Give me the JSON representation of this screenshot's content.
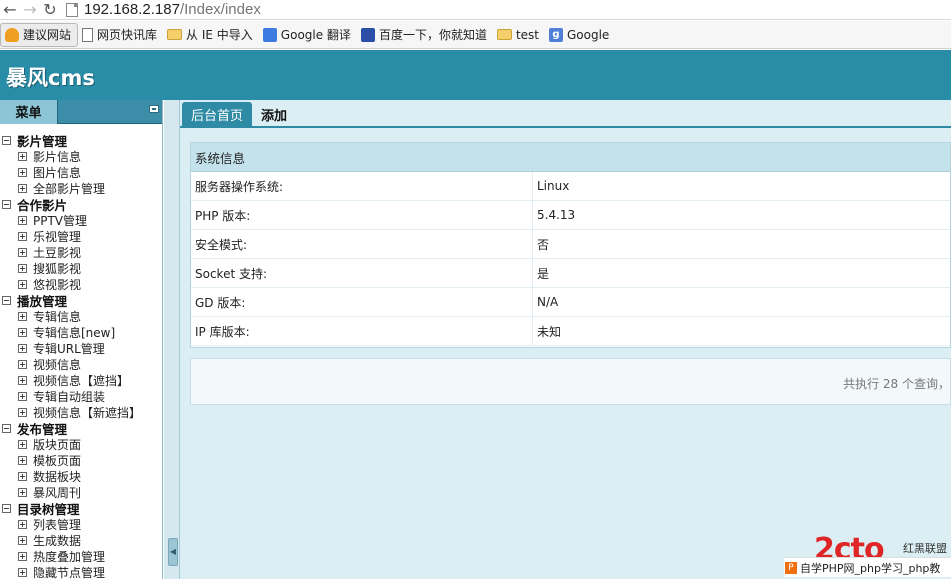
{
  "browser": {
    "url_host": "192.168.2.187",
    "url_path": "/Index/index",
    "bookmarks": [
      "建议网站",
      "网页快讯库",
      "从 IE 中导入",
      "Google 翻译",
      "百度一下，你就知道",
      "test",
      "Google"
    ]
  },
  "app": {
    "logo": "暴风cms"
  },
  "sidebar": {
    "title": "菜单",
    "groups": [
      {
        "label": "影片管理",
        "items": [
          "影片信息",
          "图片信息",
          "全部影片管理"
        ]
      },
      {
        "label": "合作影片",
        "items": [
          "PPTV管理",
          "乐视管理",
          "土豆影视",
          "搜狐影视",
          "悠视影视"
        ]
      },
      {
        "label": "播放管理",
        "items": [
          "专辑信息",
          "专辑信息[new]",
          "专辑URL管理",
          "视频信息",
          "视频信息【遮挡】",
          "专辑自动组装",
          "视频信息【新遮挡】"
        ]
      },
      {
        "label": "发布管理",
        "items": [
          "版块页面",
          "模板页面",
          "数据板块",
          "暴风周刊"
        ]
      },
      {
        "label": "目录树管理",
        "items": [
          "列表管理",
          "生成数据",
          "热度叠加管理",
          "隐藏节点管理"
        ]
      }
    ]
  },
  "main": {
    "tabs": [
      "后台首页",
      "添加"
    ],
    "panel_title": "系统信息",
    "rows": [
      {
        "key": "服务器操作系统:",
        "value": "Linux"
      },
      {
        "key": "PHP 版本:",
        "value": "5.4.13"
      },
      {
        "key": "安全模式:",
        "value": "否"
      },
      {
        "key": "Socket 支持:",
        "value": "是"
      },
      {
        "key": "GD 版本:",
        "value": "N/A"
      },
      {
        "key": "IP 库版本:",
        "value": "未知"
      }
    ],
    "footer": "共执行 28 个查询，"
  },
  "watermark": {
    "tag": "红黑联盟",
    "bar": "自学PHP网_php学习_php教"
  }
}
